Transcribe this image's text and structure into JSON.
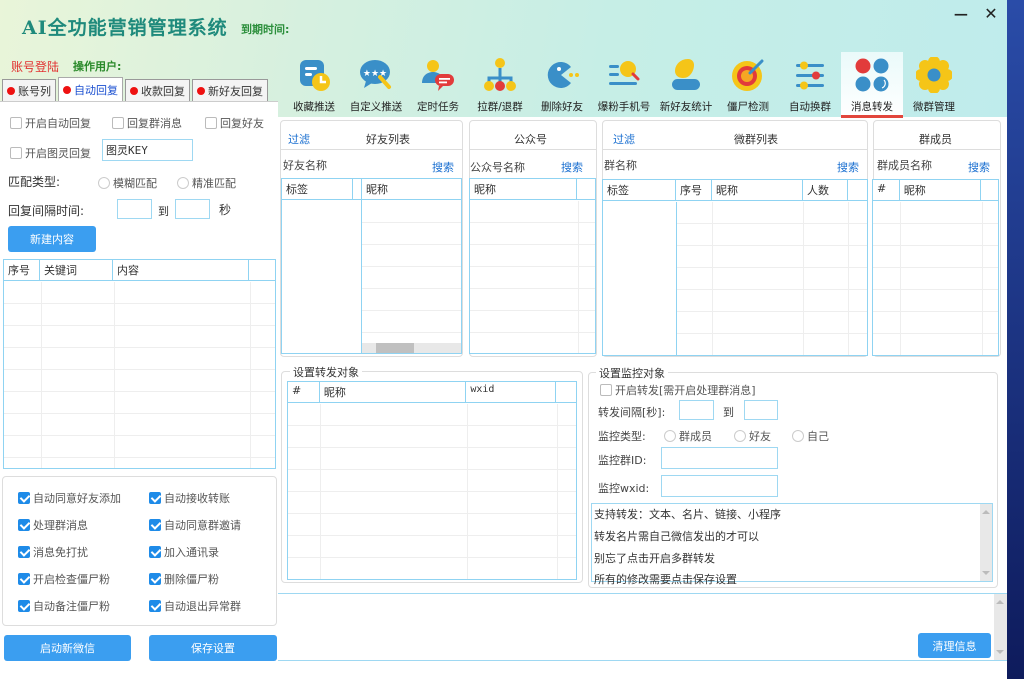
{
  "window": {
    "title": "AI全功能营销管理系统",
    "expire_label": "到期时间:",
    "minimize": "−",
    "close": "✕"
  },
  "account": {
    "login_label": "账号登陆",
    "operator_label": "操作用户:"
  },
  "left_tabs": [
    {
      "label": "账号列",
      "active": false
    },
    {
      "label": "自动回复",
      "active": true
    },
    {
      "label": "收款回复",
      "active": false
    },
    {
      "label": "新好友回复",
      "active": false
    }
  ],
  "toolbar": [
    {
      "label": "收藏推送",
      "icon": "favorites-clock-icon"
    },
    {
      "label": "自定义推送",
      "icon": "chat-bubble-stars-icon"
    },
    {
      "label": "定时任务",
      "icon": "user-message-icon"
    },
    {
      "label": "拉群/退群",
      "icon": "hierarchy-icon"
    },
    {
      "label": "删除好友",
      "icon": "pacman-icon"
    },
    {
      "label": "爆粉手机号",
      "icon": "list-search-icon"
    },
    {
      "label": "新好友统计",
      "icon": "user-stats-icon"
    },
    {
      "label": "僵尸检测",
      "icon": "target-icon"
    },
    {
      "label": "自动换群",
      "icon": "sliders-icon"
    },
    {
      "label": "消息转发",
      "icon": "four-dots-icon",
      "active": true
    },
    {
      "label": "微群管理",
      "icon": "gear-flower-icon"
    }
  ],
  "auto_reply": {
    "enable_auto_reply": "开启自动回复",
    "reply_group_msg": "回复群消息",
    "reply_friend": "回复好友",
    "enable_tuling": "开启图灵回复",
    "tuling_key_value": "图灵KEY",
    "match_type_label": "匹配类型:",
    "match_fuzzy": "模糊匹配",
    "match_exact": "精准匹配",
    "interval_label": "回复间隔时间:",
    "interval_to": "到",
    "interval_unit": "秒",
    "interval_from_value": "",
    "interval_to_value": "",
    "new_content_button": "新建内容",
    "table_columns": [
      "序号",
      "关键词",
      "内容",
      ""
    ]
  },
  "options": [
    {
      "label": "自动同意好友添加",
      "checked": true
    },
    {
      "label": "自动接收转账",
      "checked": true
    },
    {
      "label": "处理群消息",
      "checked": true
    },
    {
      "label": "自动同意群邀请",
      "checked": true
    },
    {
      "label": "消息免打扰",
      "checked": true
    },
    {
      "label": "加入通讯录",
      "checked": true
    },
    {
      "label": "开启检查僵尸粉",
      "checked": true
    },
    {
      "label": "删除僵尸粉",
      "checked": true
    },
    {
      "label": "自动备注僵尸粉",
      "checked": true
    },
    {
      "label": "自动退出异常群",
      "checked": true
    }
  ],
  "bottom_buttons": {
    "start_wechat": "启动新微信",
    "save_settings": "保存设置"
  },
  "friends_panel": {
    "filter": "过滤",
    "title": "好友列表",
    "name_label": "好友名称",
    "search": "搜索",
    "tag_col": "标签",
    "nick_col": "昵称"
  },
  "official_panel": {
    "title": "公众号",
    "name_label": "公众号名称",
    "search": "搜索",
    "nick_col": "昵称"
  },
  "groups_panel": {
    "filter": "过滤",
    "title": "微群列表",
    "name_label": "群名称",
    "search": "搜索",
    "columns": [
      "标签",
      "序号",
      "昵称",
      "人数",
      ""
    ]
  },
  "members_panel": {
    "title": "群成员",
    "name_label": "群成员名称",
    "search": "搜索",
    "columns": [
      "#",
      "昵称",
      ""
    ]
  },
  "forward_target": {
    "legend": "设置转发对象",
    "columns": [
      "#",
      "昵称",
      "wxid",
      ""
    ]
  },
  "monitor": {
    "legend": "设置监控对象",
    "enable_forward": "开启转发[需开启处理群消息]",
    "interval_label": "转发间隔[秒]:",
    "interval_to": "到",
    "type_label": "监控类型:",
    "type_member": "群成员",
    "type_friend": "好友",
    "type_self": "自己",
    "group_id_label": "监控群ID:",
    "wxid_label": "监控wxid:",
    "group_id_value": "",
    "wxid_value": "",
    "notes": [
      "支持转发：文本、名片、链接、小程序",
      "转发名片需自己微信发出的才可以",
      "别忘了点击开启多群转发",
      "所有的修改需要点击保存设置"
    ]
  },
  "log": {
    "clear_button": "清理信息"
  },
  "colors": {
    "accent_blue": "#3b9ef0",
    "active_tab_underline": "#e2463c",
    "title_green": "#1f8a7c",
    "login_red": "#e23030",
    "grid_border": "#8fd3f2"
  }
}
